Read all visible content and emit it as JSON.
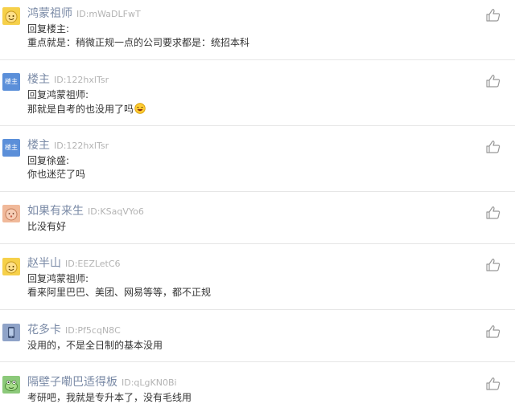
{
  "comments": [
    {
      "username": "鸿蒙祖师",
      "uid": "ID:mWaDLFwT",
      "reply_to": "回复楼主:",
      "content": "重点就是：稍微正规一点的公司要求都是：统招本科",
      "avatar_icon": "smiley-face-avatar",
      "avatar_color": "#f6d04a"
    },
    {
      "username": "楼主",
      "uid": "ID:122hxlTsr",
      "reply_to": "回复鸿蒙祖师:",
      "content": "那就是自考的也没用了吗",
      "content_emoji": "laughing-emoji",
      "avatar_text": "楼主",
      "avatar_color": "#5b8fd9"
    },
    {
      "username": "楼主",
      "uid": "ID:122hxlTsr",
      "reply_to": "回复徐盛:",
      "content": "你也迷茫了吗",
      "avatar_text": "楼主",
      "avatar_color": "#5b8fd9"
    },
    {
      "username": "如果有来生",
      "uid": "ID:KSaqVYo6",
      "content": "比没有好",
      "avatar_icon": "peach-face-avatar",
      "avatar_color": "#f0b99a"
    },
    {
      "username": "赵半山",
      "uid": "ID:EEZLetC6",
      "reply_to": "回复鸿蒙祖师:",
      "content": "看来阿里巴巴、美团、网易等等，都不正规",
      "avatar_icon": "smiley-face-avatar",
      "avatar_color": "#f6d04a"
    },
    {
      "username": "花多卡",
      "uid": "ID:Pf5cqN8C",
      "content": "没用的，不是全日制的基本没用",
      "avatar_icon": "phone-avatar",
      "avatar_color": "#8fa3c8"
    },
    {
      "username": "隔壁子嘞巴适得板",
      "uid": "ID:qLgKN0Bi",
      "content": "考研吧，我就是专升本了，没有毛线用",
      "avatar_icon": "frog-avatar",
      "avatar_color": "#8cc97a"
    }
  ],
  "like_icon": "thumbs-up-icon"
}
